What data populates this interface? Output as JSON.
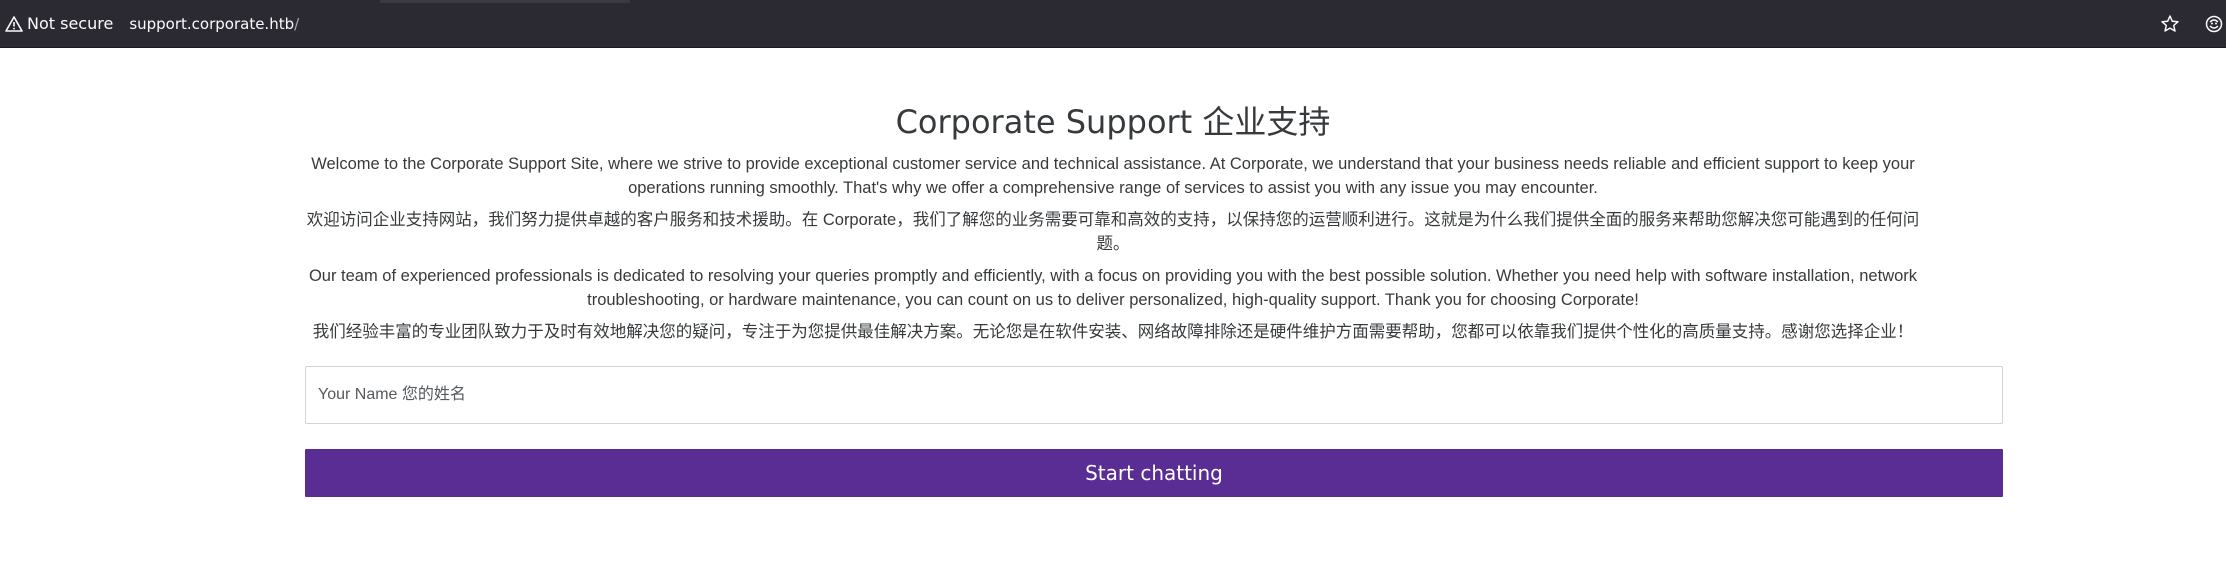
{
  "browser": {
    "security_label": "Not secure",
    "url_host": "support.corporate.htb",
    "url_path": "/",
    "icons": [
      "warning-icon",
      "star-icon",
      "extension-icon"
    ]
  },
  "page": {
    "title": "Corporate Support 企业支持",
    "paragraphs": [
      "Welcome to the Corporate Support Site, where we strive to provide exceptional customer service and technical assistance. At Corporate, we understand that your business needs reliable and efficient support to keep your operations running smoothly. That's why we offer a comprehensive range of services to assist you with any issue you may encounter.",
      "欢迎访问企业支持网站，我们努力提供卓越的客户服务和技术援助。在 Corporate，我们了解您的业务需要可靠和高效的支持，以保持您的运营顺利进行。这就是为什么我们提供全面的服务来帮助您解决您可能遇到的任何问题。",
      "Our team of experienced professionals is dedicated to resolving your queries promptly and efficiently, with a focus on providing you with the best possible solution. Whether you need help with software installation, network troubleshooting, or hardware maintenance, you can count on us to deliver personalized, high-quality support. Thank you for choosing Corporate!",
      "我们经验丰富的专业团队致力于及时有效地解决您的疑问，专注于为您提供最佳解决方案。无论您是在软件安装、网络故障排除还是硬件维护方面需要帮助，您都可以依靠我们提供个性化的高质量支持。感谢您选择企业！"
    ],
    "name_input": {
      "value": "",
      "placeholder": "Your Name 您的姓名"
    },
    "start_button_label": "Start chatting",
    "colors": {
      "accent": "#5a2d94",
      "text": "#373a3c",
      "toolbar": "#2b2a33"
    }
  }
}
